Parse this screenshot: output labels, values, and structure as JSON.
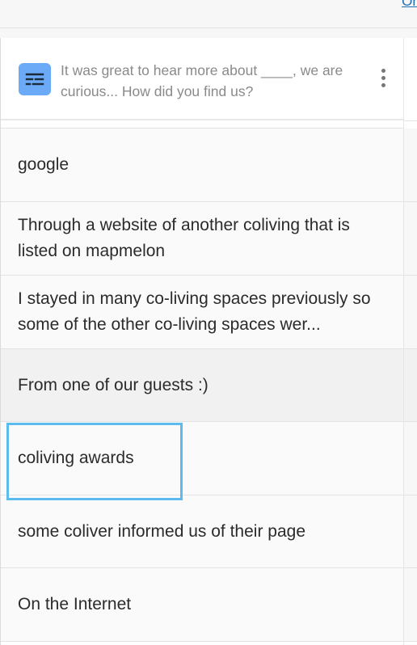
{
  "top": {
    "link_text": "Or"
  },
  "question": {
    "icon": "text-lines-icon",
    "text": "It was great to hear more about ____, we are curious... How did you find us?",
    "menu_icon": "vertical-ellipsis-icon"
  },
  "responses": [
    {
      "text": "google"
    },
    {
      "text": "Through a website of another coliving that is listed on mapmelon"
    },
    {
      "text": "I stayed in many co-living spaces previously so some of the other co-living spaces wer..."
    },
    {
      "text": "From one of our guests :)"
    },
    {
      "text": "coliving awards"
    },
    {
      "text": "some coliver informed us of their page"
    },
    {
      "text": "On the Internet"
    }
  ],
  "colors": {
    "icon_bg": "#6aaaf7",
    "focus_outline": "#5cbcf0",
    "link": "#1c6fb3"
  }
}
